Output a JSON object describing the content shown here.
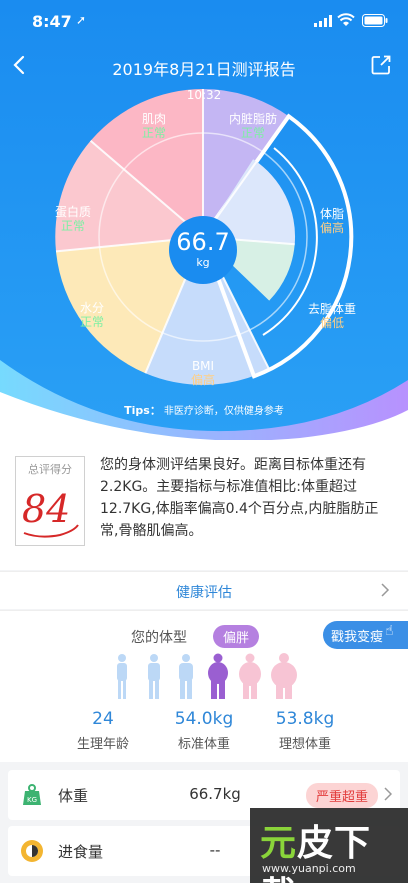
{
  "status": {
    "time": "8:47",
    "location_arrow": "➚"
  },
  "header": {
    "title": "2019年8月21日测评报告",
    "time": "10:32"
  },
  "score_center": {
    "value": "66.7",
    "unit": "kg"
  },
  "segments": [
    {
      "name": "肌肉",
      "status": "正常"
    },
    {
      "name": "内脏脂肪",
      "status": "正常"
    },
    {
      "name": "体脂",
      "status": "偏高"
    },
    {
      "name": "去脂体重",
      "status": "偏低"
    },
    {
      "name": "BMI",
      "status": "偏高"
    },
    {
      "name": "水分",
      "status": "正常"
    },
    {
      "name": "蛋白质",
      "status": "正常"
    }
  ],
  "tips": {
    "label": "Tips：",
    "text": "非医疗诊断，仅供健身参考"
  },
  "summary": {
    "score_label": "总评得分",
    "score": "84",
    "text": "您的身体测评结果良好。距离目标体重还有2.2KG。主要指标与标准值相比:体重超过12.7KG,体脂率偏高0.4个百分点,内脏脂肪正常,骨骼肌偏高。"
  },
  "assessment": {
    "label": "健康评估"
  },
  "body_type": {
    "label": "您的体型",
    "value": "偏胖",
    "change_button": "戳我变瘦",
    "stats": [
      {
        "value": "24",
        "label": "生理年龄"
      },
      {
        "value": "54.0kg",
        "label": "标准体重"
      },
      {
        "value": "53.8kg",
        "label": "理想体重"
      }
    ]
  },
  "rows": [
    {
      "name": "体重",
      "value": "66.7kg",
      "tag": "严重超重",
      "icon": "kg-weight-icon"
    },
    {
      "name": "进食量",
      "value": "--",
      "icon": "food-icon"
    }
  ],
  "watermark": {
    "brand_a": "元",
    "brand_b": "皮下载",
    "url": "www.yuanpi.com"
  },
  "colors": {
    "header_blue": "#1f8ef0",
    "accent_blue": "#2f87d8",
    "purple": "#b580e0",
    "normal_green": "#7ef0a4",
    "high_orange": "#ffcf86",
    "danger_red": "#e23c3c"
  }
}
